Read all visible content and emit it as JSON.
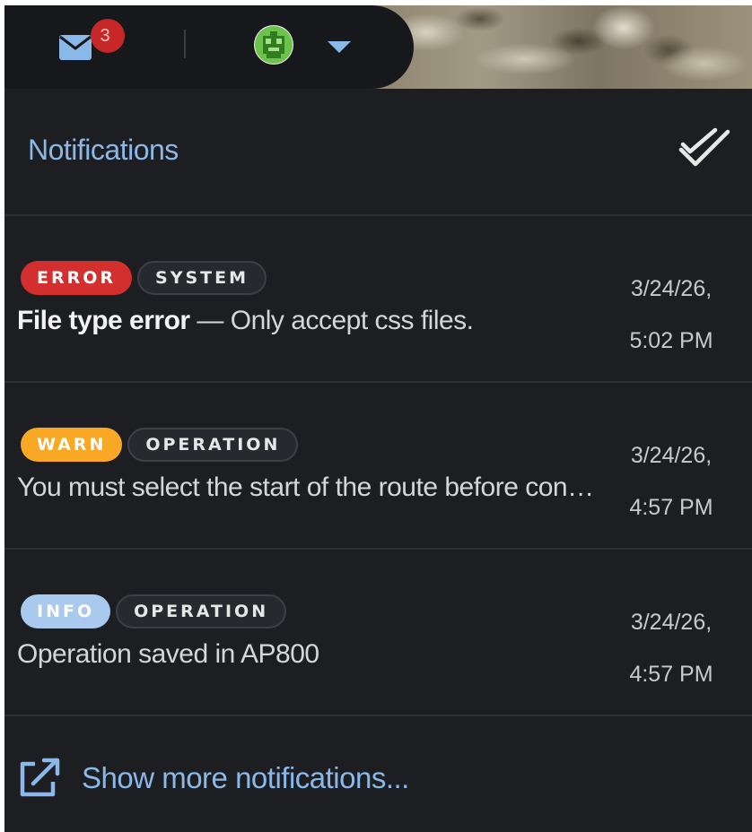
{
  "topbar": {
    "mail_badge_count": "3",
    "icons": {
      "mail": "mail-icon",
      "avatar": "avatar-icon",
      "caret": "caret-down-icon"
    }
  },
  "notifications": {
    "title": "Notifications",
    "mark_all_icon": "double-check-icon",
    "items": [
      {
        "level": "ERROR",
        "level_color": "#d32f2f",
        "category": "SYSTEM",
        "title": "File type error",
        "separator": " — ",
        "message": "Only accept css files.",
        "date": "3/24/26,",
        "time": "5:02 PM"
      },
      {
        "level": "WARN",
        "level_color": "#f9a825",
        "category": "OPERATION",
        "title": "",
        "separator": "",
        "message": "You must select the start of the route before continuing.",
        "date": "3/24/26,",
        "time": "4:57 PM"
      },
      {
        "level": "INFO",
        "level_color": "#a9c9ee",
        "category": "OPERATION",
        "title": "",
        "separator": "",
        "message": "Operation saved in AP800",
        "date": "3/24/26,",
        "time": "4:57 PM"
      }
    ],
    "show_more_label": "Show more notifications...",
    "show_more_icon": "external-link-icon"
  },
  "colors": {
    "accent": "#8ab8e8",
    "panel_bg": "#1c1e22",
    "divider": "#2e3137",
    "badge_red": "#c62828"
  }
}
